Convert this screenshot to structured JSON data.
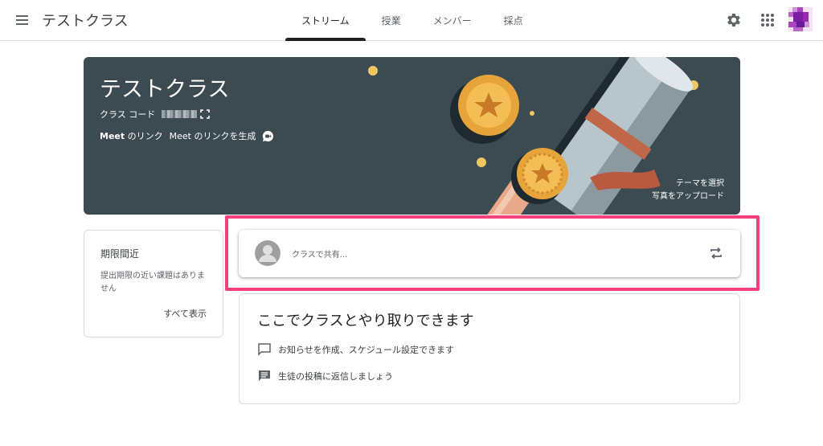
{
  "header": {
    "title": "テストクラス",
    "tabs": [
      {
        "label": "ストリーム",
        "active": true
      },
      {
        "label": "授業",
        "active": false
      },
      {
        "label": "メンバー",
        "active": false
      },
      {
        "label": "採点",
        "active": false
      }
    ],
    "icons": [
      "menu-icon",
      "settings-icon",
      "apps-grid-icon",
      "user-avatar"
    ]
  },
  "banner": {
    "title": "テストクラス",
    "class_code_label": "クラス コード",
    "meet_label_bold": "Meet",
    "meet_label_rest": " のリンク",
    "meet_link": "Meet のリンクを生成",
    "select_theme": "テーマを選択",
    "upload_photo": "写真をアップロード",
    "background_color": "#3c4a52"
  },
  "upcoming": {
    "title": "期限間近",
    "text": "提出期限の近い課題はありません",
    "view_all": "すべて表示"
  },
  "share": {
    "placeholder": "クラスで共有...",
    "highlight_color": "#f5407c"
  },
  "info": {
    "title": "ここでクラスとやり取りできます",
    "items": [
      {
        "icon": "announcement-icon",
        "text": "お知らせを作成、スケジュール設定できます"
      },
      {
        "icon": "comments-icon",
        "text": "生徒の投稿に返信しましょう"
      }
    ]
  }
}
